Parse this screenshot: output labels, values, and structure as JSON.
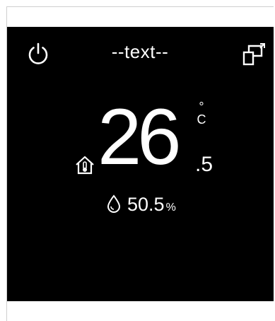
{
  "header": {
    "title": "--text--",
    "power_icon": "power-icon",
    "switch_icon": "switch-screen-icon"
  },
  "temperature": {
    "integer": "26",
    "decimal": ".5",
    "unit_degree": "°",
    "unit_letter": "C",
    "mode_icon": "house-thermometer-icon"
  },
  "humidity": {
    "value": "50.5",
    "unit": "%",
    "icon": "water-drop-icon"
  },
  "colors": {
    "screen_background": "#000000",
    "foreground": "#ffffff",
    "page_background": "#ffffff"
  }
}
